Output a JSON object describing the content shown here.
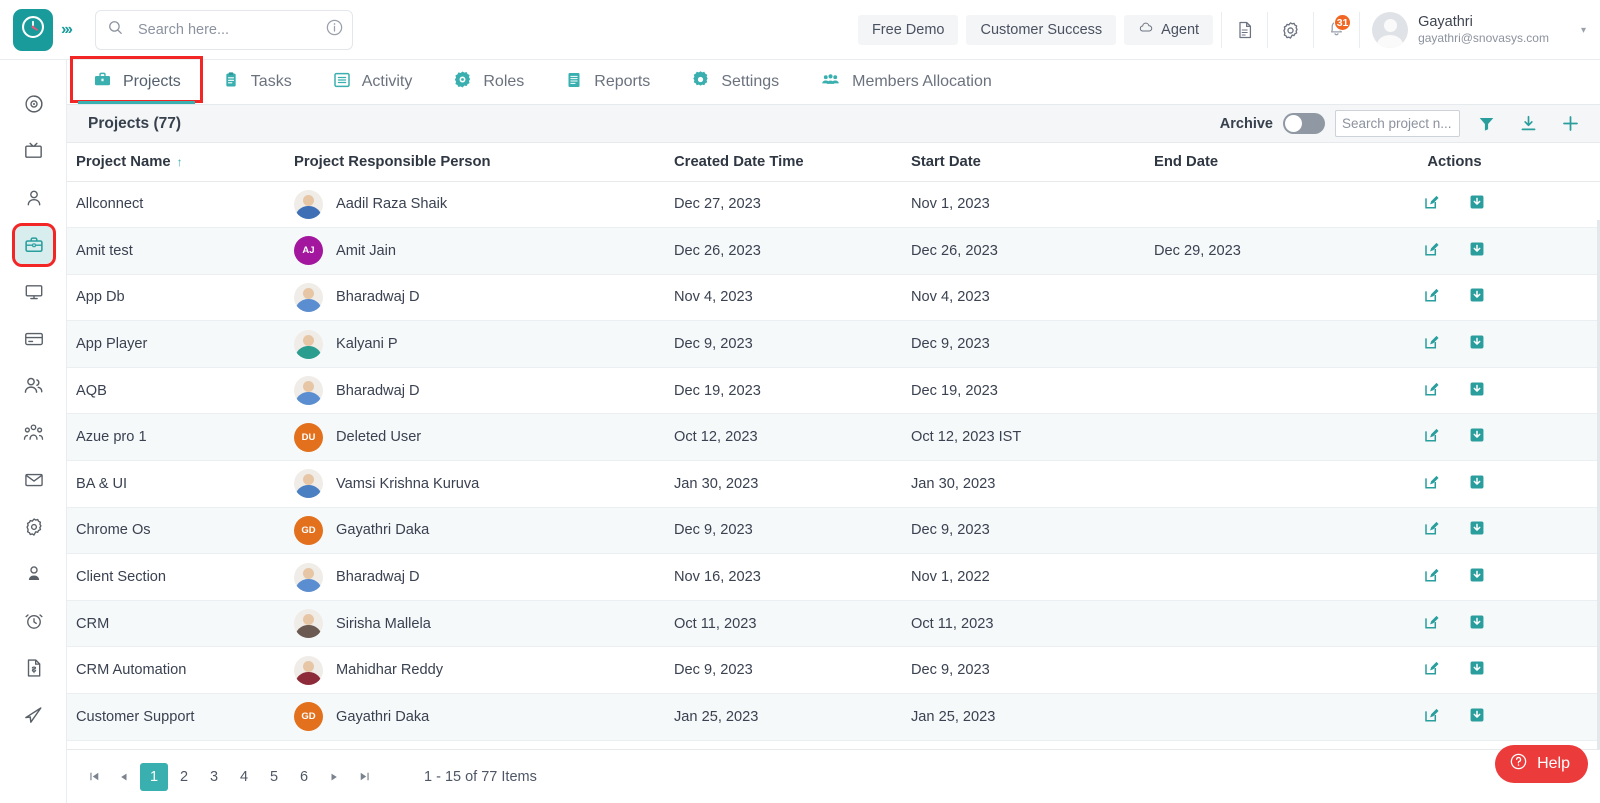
{
  "topbar": {
    "logo_icon": "clock-logo-icon",
    "expand_icon": "expand-chevrons-icon",
    "expand_label": "›››",
    "search": {
      "placeholder": "Search here...",
      "value": "",
      "icon": "search-icon",
      "info_icon": "info-icon"
    },
    "buttons": [
      {
        "label": "Free Demo",
        "name": "free-demo-button",
        "icon": ""
      },
      {
        "label": "Customer Success",
        "name": "customer-success-button",
        "icon": ""
      },
      {
        "label": "Agent",
        "name": "agent-button",
        "icon": "cloud-download-icon"
      }
    ],
    "doc_icon": "document-icon",
    "settings_icon": "gear-icon",
    "bell_icon": "bell-icon",
    "notification_count": "31",
    "user": {
      "name": "Gayathri",
      "email": "gayathri@snovasys.com",
      "avatar_icon": "avatar-placeholder-icon",
      "caret": "▾"
    }
  },
  "sidebar": {
    "items": [
      {
        "name": "sidebar-item-dashboard",
        "icon": "radar-target-icon",
        "active": false
      },
      {
        "name": "sidebar-item-screens",
        "icon": "tv-icon",
        "active": false
      },
      {
        "name": "sidebar-item-contacts",
        "icon": "person-icon",
        "active": false
      },
      {
        "name": "sidebar-item-projects",
        "icon": "briefcase-icon",
        "active": true
      },
      {
        "name": "sidebar-item-devices",
        "icon": "monitor-icon",
        "active": false
      },
      {
        "name": "sidebar-item-payments",
        "icon": "credit-card-icon",
        "active": false
      },
      {
        "name": "sidebar-item-teams",
        "icon": "two-people-icon",
        "active": false
      },
      {
        "name": "sidebar-item-groups",
        "icon": "group-people-icon",
        "active": false
      },
      {
        "name": "sidebar-item-mail",
        "icon": "envelope-icon",
        "active": false
      },
      {
        "name": "sidebar-item-settings",
        "icon": "gear-icon",
        "active": false
      },
      {
        "name": "sidebar-item-profile",
        "icon": "user-profile-icon",
        "active": false
      },
      {
        "name": "sidebar-item-timesheet",
        "icon": "alarm-clock-icon",
        "active": false
      },
      {
        "name": "sidebar-item-invoices",
        "icon": "invoice-icon",
        "active": false
      },
      {
        "name": "sidebar-item-send",
        "icon": "paper-plane-icon",
        "active": false
      }
    ]
  },
  "tabs": [
    {
      "label": "Projects",
      "icon": "briefcase-icon",
      "active": true
    },
    {
      "label": "Tasks",
      "icon": "clipboard-icon",
      "active": false
    },
    {
      "label": "Activity",
      "icon": "list-box-icon",
      "active": false
    },
    {
      "label": "Roles",
      "icon": "gear-circle-icon",
      "active": false
    },
    {
      "label": "Reports",
      "icon": "report-lines-icon",
      "active": false
    },
    {
      "label": "Settings",
      "icon": "gear-icon",
      "active": false
    },
    {
      "label": "Members Allocation",
      "icon": "members-icon",
      "active": false
    }
  ],
  "panel": {
    "title": "Projects  (77)",
    "archive_label": "Archive",
    "archive_on": false,
    "search_placeholder": "Search project n...",
    "search_value": "",
    "filter_icon": "funnel-filter-icon",
    "download_icon": "download-icon",
    "add_icon": "plus-icon"
  },
  "table": {
    "columns": [
      {
        "label": "Project Name",
        "sorted": true,
        "sort_arrow": "↑"
      },
      {
        "label": "Project Responsible Person"
      },
      {
        "label": "Created Date Time"
      },
      {
        "label": "Start Date"
      },
      {
        "label": "End Date"
      },
      {
        "label": "Actions"
      }
    ],
    "rows": [
      {
        "project": "Allconnect",
        "person": "Aadil Raza Shaik",
        "avatar_type": "photo",
        "avatar_initials": "",
        "avatar_color": "#3f6fb5",
        "created": "Dec 27, 2023",
        "start": "Nov 1, 2023",
        "end": ""
      },
      {
        "project": "Amit test",
        "person": "Amit Jain",
        "avatar_type": "initials",
        "avatar_initials": "AJ",
        "avatar_color": "#a3179e",
        "created": "Dec 26, 2023",
        "start": "Dec 26, 2023",
        "end": "Dec 29, 2023"
      },
      {
        "project": "App Db",
        "person": "Bharadwaj D",
        "avatar_type": "photo",
        "avatar_initials": "",
        "avatar_color": "#5b8ed0",
        "created": "Nov 4, 2023",
        "start": "Nov 4, 2023",
        "end": ""
      },
      {
        "project": "App Player",
        "person": "Kalyani P",
        "avatar_type": "photo",
        "avatar_initials": "",
        "avatar_color": "#2a9d8f",
        "created": "Dec 9, 2023",
        "start": "Dec 9, 2023",
        "end": ""
      },
      {
        "project": "AQB",
        "person": "Bharadwaj D",
        "avatar_type": "photo",
        "avatar_initials": "",
        "avatar_color": "#5b8ed0",
        "created": "Dec 19, 2023",
        "start": "Dec 19, 2023",
        "end": ""
      },
      {
        "project": "Azue pro 1",
        "person": "Deleted User",
        "avatar_type": "initials",
        "avatar_initials": "DU",
        "avatar_color": "#e2701c",
        "created": "Oct 12, 2023",
        "start": "Oct 12, 2023 IST",
        "end": ""
      },
      {
        "project": "BA & UI",
        "person": "Vamsi Krishna Kuruva",
        "avatar_type": "photo",
        "avatar_initials": "",
        "avatar_color": "#4a7fc1",
        "created": "Jan 30, 2023",
        "start": "Jan 30, 2023",
        "end": ""
      },
      {
        "project": "Chrome Os",
        "person": "Gayathri Daka",
        "avatar_type": "initials",
        "avatar_initials": "GD",
        "avatar_color": "#e2701c",
        "created": "Dec 9, 2023",
        "start": "Dec 9, 2023",
        "end": ""
      },
      {
        "project": "Client Section",
        "person": "Bharadwaj D",
        "avatar_type": "photo",
        "avatar_initials": "",
        "avatar_color": "#5b8ed0",
        "created": "Nov 16, 2023",
        "start": "Nov 1, 2022",
        "end": ""
      },
      {
        "project": "CRM",
        "person": "Sirisha Mallela",
        "avatar_type": "photo",
        "avatar_initials": "",
        "avatar_color": "#6b5a52",
        "created": "Oct 11, 2023",
        "start": "Oct 11, 2023",
        "end": ""
      },
      {
        "project": "CRM Automation",
        "person": "Mahidhar Reddy",
        "avatar_type": "photo",
        "avatar_initials": "",
        "avatar_color": "#8e2b3a",
        "created": "Dec 9, 2023",
        "start": "Dec 9, 2023",
        "end": ""
      },
      {
        "project": "Customer Support",
        "person": "Gayathri Daka",
        "avatar_type": "initials",
        "avatar_initials": "GD",
        "avatar_color": "#e2701c",
        "created": "Jan 25, 2023",
        "start": "Jan 25, 2023",
        "end": ""
      }
    ],
    "row_actions": {
      "edit_icon": "edit-pencil-icon",
      "archive_icon": "archive-box-icon"
    }
  },
  "pager": {
    "first_label": "⏮",
    "prev_label": "◀",
    "next_label": "▶",
    "last_label": "⏭",
    "pages": [
      "1",
      "2",
      "3",
      "4",
      "5",
      "6"
    ],
    "current": "1",
    "info": "1 - 15 of 77 Items"
  },
  "help": {
    "label": "Help",
    "icon": "question-circle-icon"
  },
  "colors": {
    "accent": "#3aafaf",
    "logo": "#1a9b9b",
    "badge": "#f26522",
    "help": "#ec3b3b",
    "highlight": "#f32626"
  }
}
